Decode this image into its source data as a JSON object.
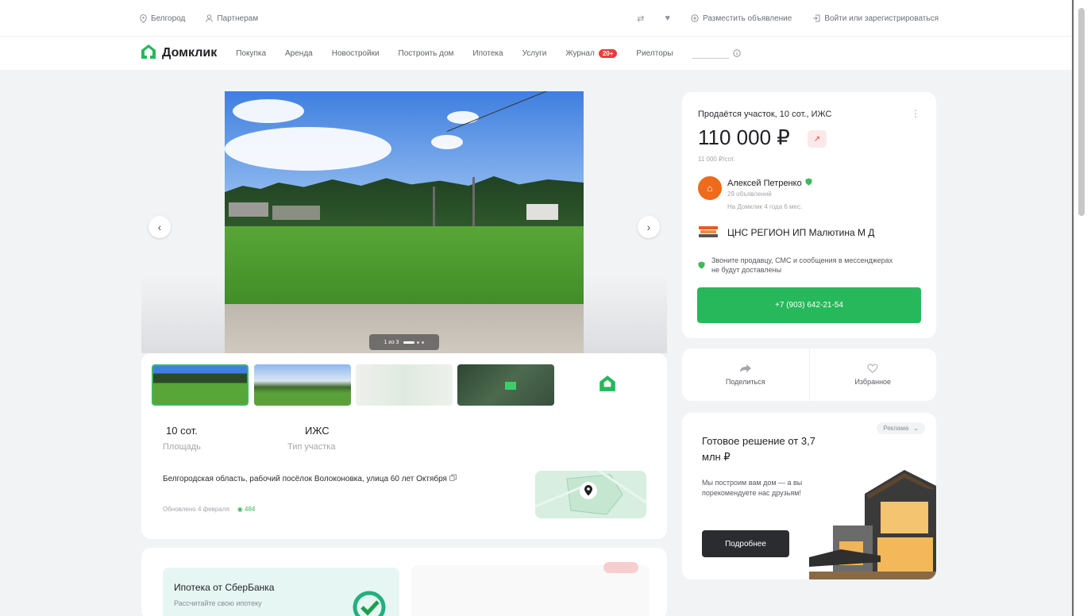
{
  "topbar": {
    "city": "Белгород",
    "partners": "Партнерам",
    "post_ad": "Разместить объявление",
    "login": "Войти или зарегистрироваться"
  },
  "nav": {
    "logo": "Домклик",
    "items": [
      "Покупка",
      "Аренда",
      "Новостройки",
      "Построить дом",
      "Ипотека",
      "Услуги",
      "Журнал",
      "Риелторы"
    ],
    "journal_badge": "20+"
  },
  "gallery": {
    "counter": "1 из 3"
  },
  "params": {
    "area_value": "10 сот.",
    "area_label": "Площадь",
    "type_value": "ИЖС",
    "type_label": "Тип участка"
  },
  "address": "Белгородская область, рабочий посёлок Волоконовка, улица 60 лет Октября",
  "meta": {
    "updated": "Обновлено 4 февраля",
    "views": "484"
  },
  "offer": {
    "title": "Продаётся участок, 10 сот., ИЖС",
    "price": "110 000 ₽",
    "price_per": "11 000 ₽/сот.",
    "seller_name": "Алексей Петренко",
    "seller_ads": "29 объявлений",
    "seller_since": "На Домклик 4 года 6 мес.",
    "agency": "ЦНС РЕГИОН ИП Малютина М Д",
    "warning": "Звоните продавцу, СМС и сообщения в мессенджерах не будут доставлены",
    "phone": "+7 (903) 642-21-54"
  },
  "actions": {
    "share": "Поделиться",
    "favorite": "Избранное"
  },
  "ad": {
    "tag": "Реклама",
    "title": "Готовое решение от 3,7 млн ₽",
    "text": "Мы построим вам дом — а вы порекомендуете нас друзьям!",
    "button": "Подробнее"
  },
  "sber": {
    "title": "Ипотека от СберБанка",
    "subtitle": "Рассчитайте свою ипотеку"
  },
  "colors": {
    "brand_green": "#26b85a",
    "accent_red": "#ef3a3a"
  }
}
